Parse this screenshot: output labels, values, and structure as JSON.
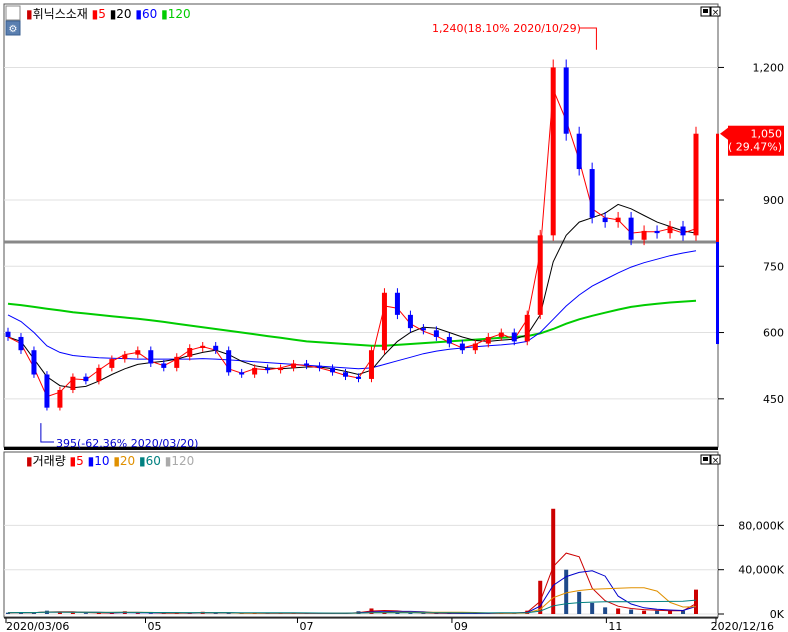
{
  "legend_top": {
    "title": "휘닉스소재",
    "items": [
      {
        "label": "5",
        "color": "#ff0000"
      },
      {
        "label": "20",
        "color": "#000000"
      },
      {
        "label": "60",
        "color": "#0000ff"
      },
      {
        "label": "120",
        "color": "#00cc00"
      }
    ]
  },
  "legend_bottom": {
    "title": "거래량",
    "items": [
      {
        "label": "5",
        "color": "#ff0000"
      },
      {
        "label": "10",
        "color": "#0000ff"
      },
      {
        "label": "20",
        "color": "#e09000"
      },
      {
        "label": "60",
        "color": "#008080"
      },
      {
        "label": "120",
        "color": "#aaaaaa"
      }
    ]
  },
  "annotations": {
    "high": "1,240(18.10% 2020/10/29)",
    "low": "395(-62.36% 2020/03/20)",
    "current_price": "1,050",
    "current_change": "( 29.47%)"
  },
  "chart_data": {
    "type": "candlestick",
    "price_axis": {
      "ticks": [
        "1,200",
        "900",
        "750",
        "600",
        "450"
      ],
      "tick_values": [
        1200,
        900,
        750,
        600,
        450
      ],
      "ylim": [
        350,
        1330
      ]
    },
    "volume_axis": {
      "ticks": [
        "80,000K",
        "40,000K",
        "0K"
      ],
      "tick_values": [
        80000,
        40000,
        0
      ],
      "ylim": [
        0,
        130000
      ]
    },
    "x_labels": [
      "2020/03/06",
      "05",
      "07",
      "09",
      "11",
      "2020/12/16"
    ],
    "x_label_dates": [
      "2020-03-06",
      "2020-05-01",
      "2020-07-01",
      "2020-09-01",
      "2020-11-02",
      "2020-12-16"
    ],
    "reference_line": 805,
    "high": {
      "value": 1240,
      "date": "2020-10-29"
    },
    "low": {
      "value": 395,
      "date": "2020-03-20"
    },
    "close": [
      590,
      560,
      505,
      430,
      470,
      500,
      490,
      520,
      540,
      550,
      560,
      530,
      520,
      545,
      565,
      570,
      560,
      510,
      505,
      520,
      515,
      520,
      530,
      525,
      520,
      510,
      500,
      495,
      560,
      690,
      640,
      610,
      605,
      590,
      575,
      560,
      575,
      590,
      600,
      580,
      640,
      820,
      1200,
      1050,
      970,
      860,
      850,
      860,
      810,
      830,
      825,
      840,
      820,
      1050
    ],
    "ma5": [
      590,
      575,
      520,
      455,
      465,
      495,
      493,
      515,
      535,
      550,
      555,
      535,
      525,
      540,
      560,
      568,
      560,
      518,
      508,
      518,
      516,
      520,
      528,
      525,
      520,
      512,
      503,
      497,
      540,
      660,
      655,
      620,
      603,
      592,
      578,
      565,
      573,
      587,
      597,
      585,
      630,
      780,
      1150,
      1080,
      990,
      880,
      860,
      855,
      825,
      828,
      828,
      835,
      825,
      835
    ],
    "ma20": [
      590,
      580,
      540,
      500,
      480,
      475,
      478,
      490,
      505,
      518,
      528,
      532,
      535,
      540,
      548,
      555,
      560,
      550,
      535,
      525,
      520,
      518,
      520,
      522,
      522,
      518,
      512,
      505,
      515,
      550,
      580,
      600,
      612,
      610,
      600,
      590,
      582,
      580,
      583,
      585,
      595,
      640,
      760,
      820,
      850,
      860,
      870,
      890,
      880,
      865,
      850,
      840,
      830,
      825
    ],
    "ma60": [
      640,
      625,
      600,
      570,
      555,
      548,
      545,
      543,
      542,
      541,
      540,
      540,
      540,
      540,
      540,
      541,
      540,
      538,
      536,
      534,
      532,
      530,
      528,
      526,
      524,
      522,
      520,
      518,
      520,
      528,
      536,
      544,
      552,
      558,
      562,
      565,
      568,
      570,
      572,
      575,
      580,
      600,
      630,
      660,
      685,
      705,
      720,
      735,
      748,
      758,
      766,
      774,
      780,
      785
    ],
    "ma120": [
      665,
      662,
      658,
      654,
      650,
      646,
      643,
      640,
      637,
      634,
      631,
      628,
      624,
      620,
      616,
      612,
      608,
      604,
      600,
      596,
      592,
      588,
      584,
      580,
      578,
      576,
      574,
      572,
      570,
      570,
      572,
      574,
      576,
      578,
      580,
      582,
      584,
      586,
      588,
      590,
      592,
      598,
      608,
      620,
      630,
      638,
      645,
      652,
      658,
      662,
      665,
      668,
      670,
      672
    ],
    "volume": [
      1200,
      1500,
      1000,
      3000,
      2000,
      1200,
      800,
      900,
      1000,
      2500,
      800,
      600,
      700,
      900,
      800,
      2000,
      700,
      600,
      500,
      800,
      700,
      600,
      500,
      600,
      500,
      500,
      700,
      2500,
      5000,
      2000,
      1500,
      800,
      600,
      500,
      500,
      500,
      600,
      800,
      700,
      1000,
      3000,
      30000,
      95000,
      40000,
      20000,
      10000,
      6000,
      5000,
      4000,
      3000,
      3000,
      3000,
      3000,
      22000
    ]
  }
}
